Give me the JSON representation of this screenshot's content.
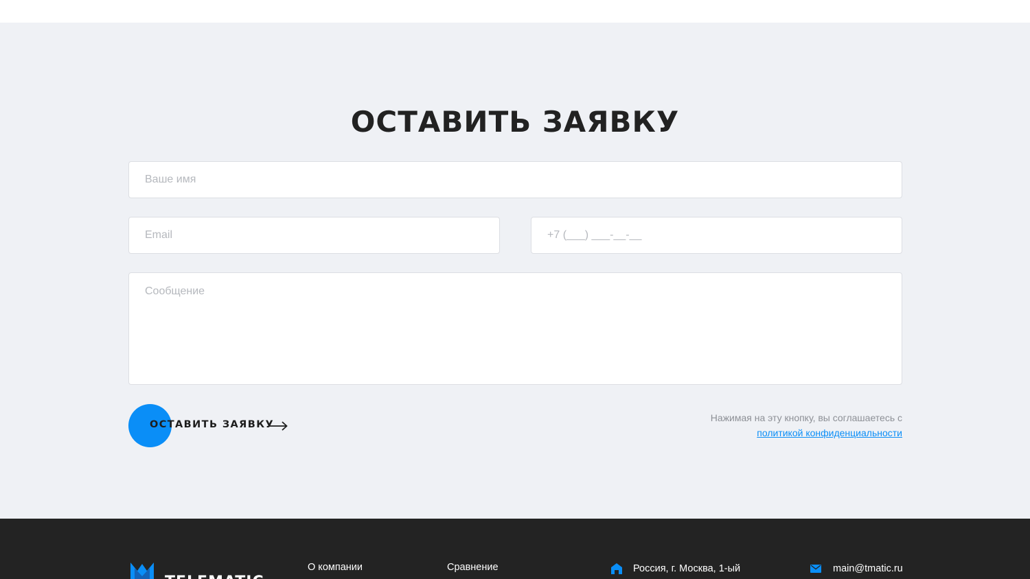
{
  "form": {
    "title": "ОСТАВИТЬ ЗАЯВКУ",
    "name_placeholder": "Ваше имя",
    "email_placeholder": "Email",
    "phone_placeholder": "+7 (___) ___-__-__",
    "message_placeholder": "Сообщение",
    "submit_label": "ОСТАВИТЬ ЗАЯВКУ",
    "consent_text": "Нажимая на эту кнопку, вы соглашаетесь с",
    "consent_link": "политикой конфиденциальности"
  },
  "footer": {
    "logo_text": "TELEMATIC",
    "links": [
      "О компании",
      "Сравнение"
    ],
    "address": "Россия, г. Москва, 1-ый",
    "email": "main@tmatic.ru"
  },
  "colors": {
    "accent": "#0a8ef7",
    "section_bg": "#eff1f5",
    "footer_bg": "#232323",
    "title": "#222222"
  },
  "icons": {
    "submit_arrow": "arrow-right-icon",
    "address": "home-icon",
    "email": "mail-icon",
    "logo": "crown-logo-icon"
  }
}
